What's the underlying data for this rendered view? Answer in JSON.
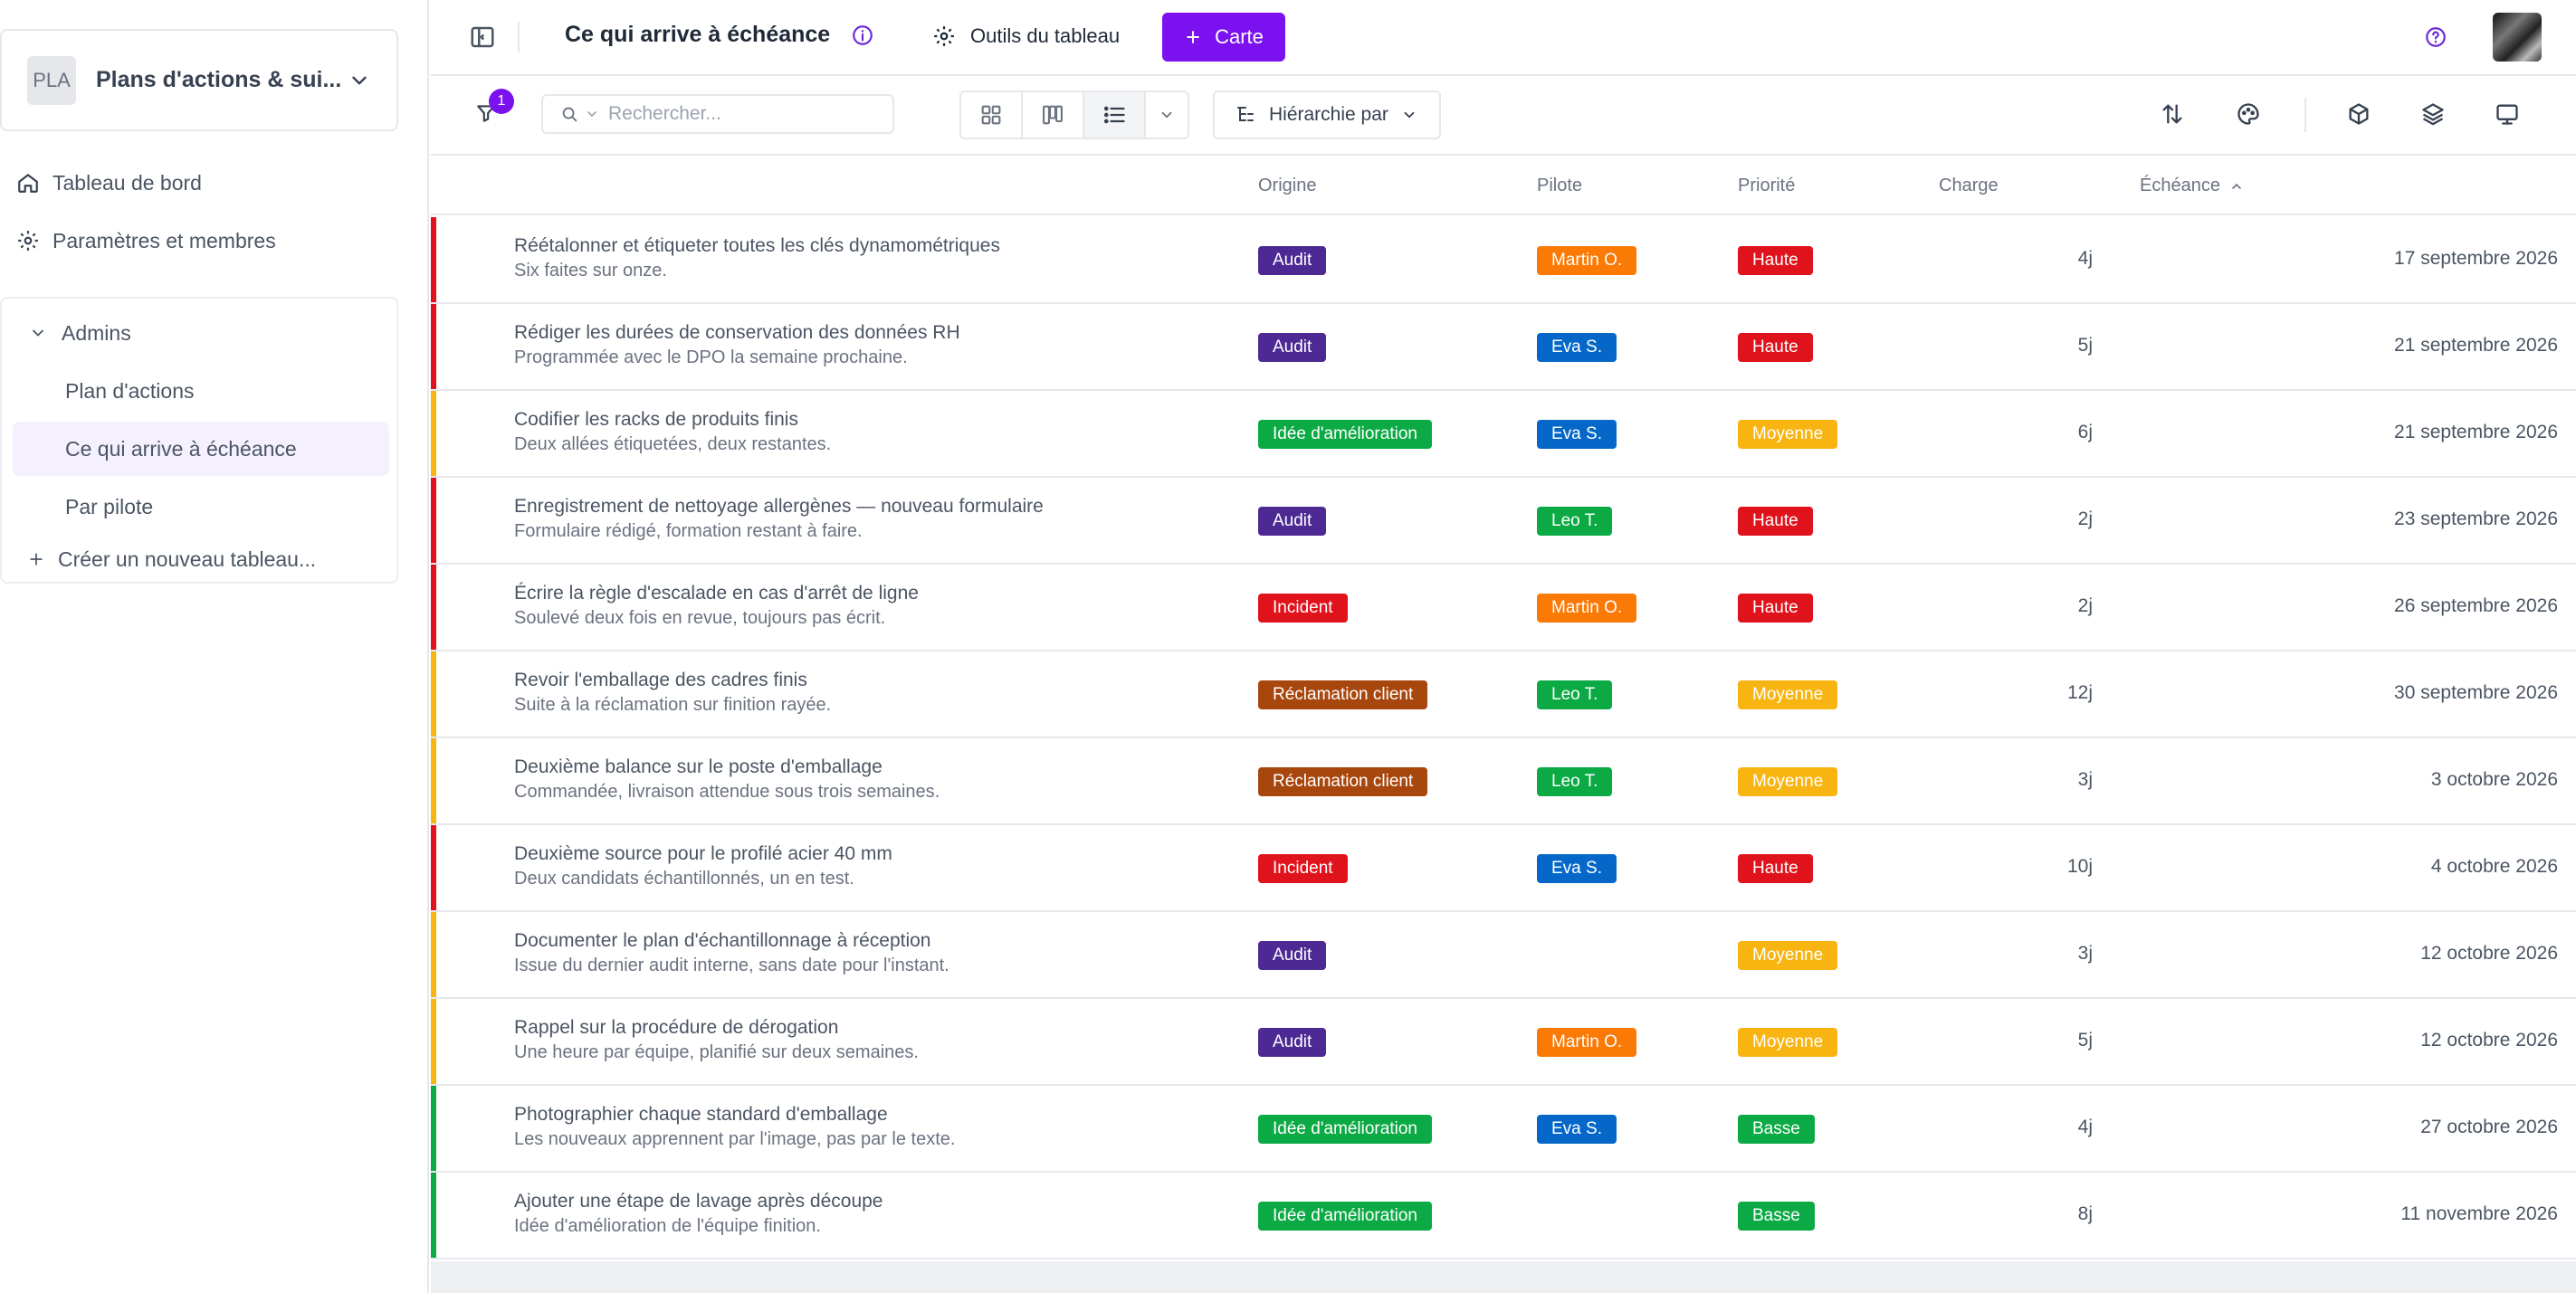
{
  "workspace": {
    "avatar_text": "PLA",
    "name": "Plans d'actions & sui..."
  },
  "nav": {
    "dashboard": "Tableau de bord",
    "settings": "Paramètres et membres",
    "group_title": "Admins",
    "group_items": [
      "Plan d'actions",
      "Ce qui arrive à échéance",
      "Par pilote"
    ],
    "create_board": "Créer un nouveau tableau..."
  },
  "topbar": {
    "title": "Ce qui arrive à échéance",
    "tools_label": "Outils du tableau",
    "card_button": "Carte"
  },
  "toolbar": {
    "filter_count": "1",
    "search_placeholder": "Rechercher...",
    "hierarchy_label": "Hiérarchie par"
  },
  "columns": {
    "origin": "Origine",
    "pilot": "Pilote",
    "priority": "Priorité",
    "charge": "Charge",
    "due": "Échéance"
  },
  "colors": {
    "accent": "#7c11f0",
    "priority_haute": "#e0121b",
    "priority_moyenne": "#f8b511",
    "priority_basse": "#0caa45",
    "origin_audit": "#4d2a93",
    "origin_amelioration": "#0caa45",
    "origin_incident": "#e0121b",
    "origin_reclamation": "#a8470d",
    "pilot_martin": "#fb7a06",
    "pilot_eva": "#0568c9",
    "pilot_leo": "#0caa45"
  },
  "rows": [
    {
      "title": "Réétalonner et étiqueter toutes les clés dynamométriques",
      "subtitle": "Six faites sur onze.",
      "origin": "Audit",
      "pilot": "Martin O.",
      "priority": "Haute",
      "charge": "4j",
      "due": "17 septembre 2026"
    },
    {
      "title": "Rédiger les durées de conservation des données RH",
      "subtitle": "Programmée avec le DPO la semaine prochaine.",
      "origin": "Audit",
      "pilot": "Eva S.",
      "priority": "Haute",
      "charge": "5j",
      "due": "21 septembre 2026"
    },
    {
      "title": "Codifier les racks de produits finis",
      "subtitle": "Deux allées étiquetées, deux restantes.",
      "origin": "Idée d'amélioration",
      "pilot": "Eva S.",
      "priority": "Moyenne",
      "charge": "6j",
      "due": "21 septembre 2026"
    },
    {
      "title": "Enregistrement de nettoyage allergènes — nouveau formulaire",
      "subtitle": "Formulaire rédigé, formation restant à faire.",
      "origin": "Audit",
      "pilot": "Leo T.",
      "priority": "Haute",
      "charge": "2j",
      "due": "23 septembre 2026"
    },
    {
      "title": "Écrire la règle d'escalade en cas d'arrêt de ligne",
      "subtitle": "Soulevé deux fois en revue, toujours pas écrit.",
      "origin": "Incident",
      "pilot": "Martin O.",
      "priority": "Haute",
      "charge": "2j",
      "due": "26 septembre 2026"
    },
    {
      "title": "Revoir l'emballage des cadres finis",
      "subtitle": "Suite à la réclamation sur finition rayée.",
      "origin": "Réclamation client",
      "pilot": "Leo T.",
      "priority": "Moyenne",
      "charge": "12j",
      "due": "30 septembre 2026"
    },
    {
      "title": "Deuxième balance sur le poste d'emballage",
      "subtitle": "Commandée, livraison attendue sous trois semaines.",
      "origin": "Réclamation client",
      "pilot": "Leo T.",
      "priority": "Moyenne",
      "charge": "3j",
      "due": "3 octobre 2026"
    },
    {
      "title": "Deuxième source pour le profilé acier 40 mm",
      "subtitle": "Deux candidats échantillonnés, un en test.",
      "origin": "Incident",
      "pilot": "Eva S.",
      "priority": "Haute",
      "charge": "10j",
      "due": "4 octobre 2026"
    },
    {
      "title": "Documenter le plan d'échantillonnage à réception",
      "subtitle": "Issue du dernier audit interne, sans date pour l'instant.",
      "origin": "Audit",
      "pilot": "",
      "priority": "Moyenne",
      "charge": "3j",
      "due": "12 octobre 2026"
    },
    {
      "title": "Rappel sur la procédure de dérogation",
      "subtitle": "Une heure par équipe, planifié sur deux semaines.",
      "origin": "Audit",
      "pilot": "Martin O.",
      "priority": "Moyenne",
      "charge": "5j",
      "due": "12 octobre 2026"
    },
    {
      "title": "Photographier chaque standard d'emballage",
      "subtitle": "Les nouveaux apprennent par l'image, pas par le texte.",
      "origin": "Idée d'amélioration",
      "pilot": "Eva S.",
      "priority": "Basse",
      "charge": "4j",
      "due": "27 octobre 2026"
    },
    {
      "title": "Ajouter une étape de lavage après découpe",
      "subtitle": "Idée d'amélioration de l'équipe finition.",
      "origin": "Idée d'amélioration",
      "pilot": "",
      "priority": "Basse",
      "charge": "8j",
      "due": "11 novembre 2026"
    }
  ]
}
